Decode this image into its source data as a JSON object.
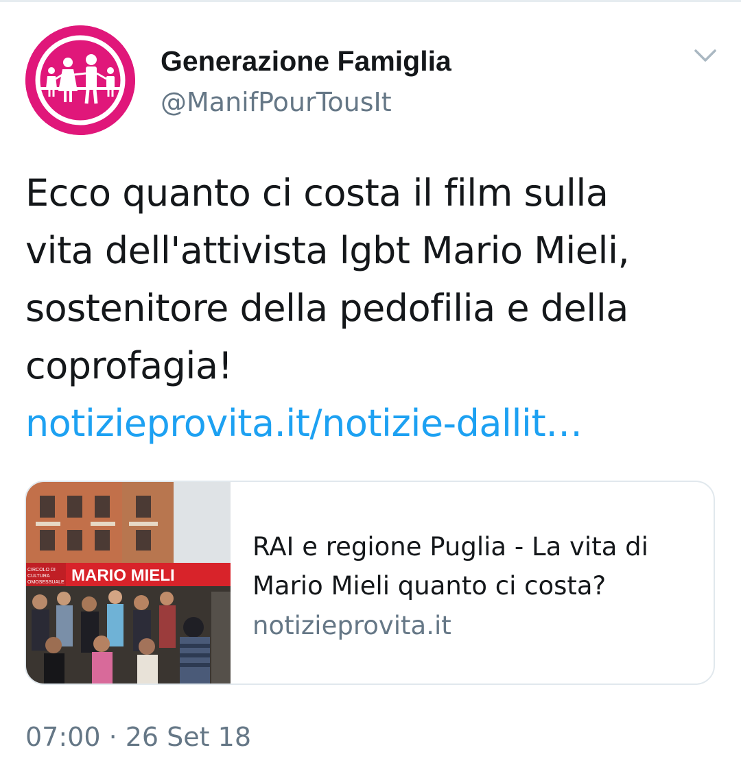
{
  "tweet": {
    "author": {
      "display_name": "Generazione Famiglia",
      "handle": "@ManifPourTousIt",
      "avatar_icon": "family-logo-icon",
      "avatar_color": "#e0177a"
    },
    "menu_icon": "chevron-down-icon",
    "text_lines": [
      "Ecco quanto ci costa il film sulla",
      "vita dell'attivista lgbt Mario Mieli,",
      "sostenitore della pedofilia e della",
      "coprofagia!"
    ],
    "link_text": "notizieprovita.it/notizie-dallit…",
    "link_color": "#1da1f2",
    "card": {
      "title_lines": [
        "RAI e regione Puglia - La vita di",
        "Mario Mieli quanto ci costa?"
      ],
      "domain": "notizieprovita.it",
      "image_banner_text": "MARIO MIELI",
      "image_side_text": "CIRCOLO DI CULTURA OMOSESSUALE"
    },
    "timestamp": "07:00 · 26 Set 18"
  }
}
